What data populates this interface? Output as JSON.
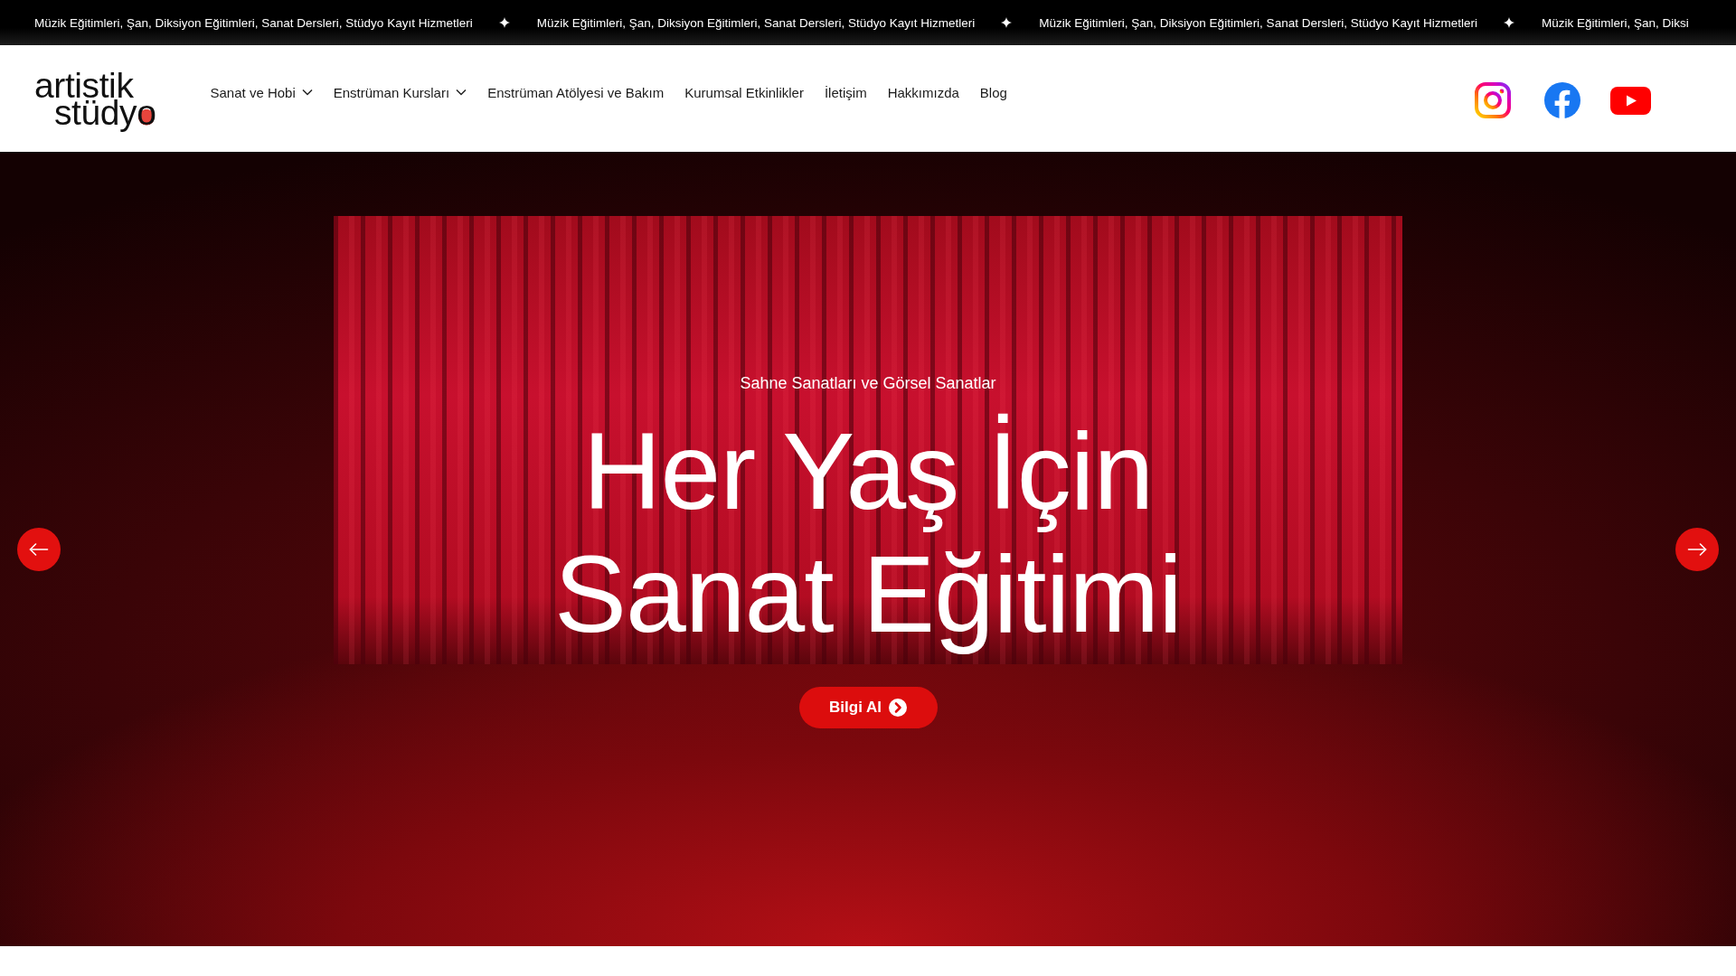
{
  "ticker": [
    "Müzik Eğitimleri, Şan, Diksiyon Eğitimleri, Sanat Dersleri, Stüdyo Kayıt Hizmetleri",
    "Müzik Eğitimleri, Şan, Diksiyon Eğitimleri, Sanat Dersleri, Stüdyo Kayıt Hizmetleri",
    "Müzik Eğitimleri, Şan, Diksiyon Eğitimleri, Sanat Dersleri, Stüdyo Kayıt Hizmetleri",
    "Müzik Eğitimleri, Şan, Diksi"
  ],
  "header": {
    "logo": [
      "artistik",
      "stüdyo"
    ],
    "nav": [
      {
        "label": "Sanat ve Hobi",
        "dropdown": true
      },
      {
        "label": "Enstrüman Kursları",
        "dropdown": true
      },
      {
        "label": "Enstrüman Atölyesi ve Bakım",
        "dropdown": false
      },
      {
        "label": "Kurumsal Etkinlikler",
        "dropdown": false
      },
      {
        "label": "İletişim",
        "dropdown": false
      },
      {
        "label": "Hakkımızda",
        "dropdown": false
      },
      {
        "label": "Blog",
        "dropdown": false
      }
    ]
  },
  "hero": {
    "eyebrow": "Sahne Sanatları ve Görsel Sanatlar",
    "headline": [
      "Her Yaş İçin",
      "Sanat Eğitimi"
    ],
    "button": "Bilgi Al"
  }
}
